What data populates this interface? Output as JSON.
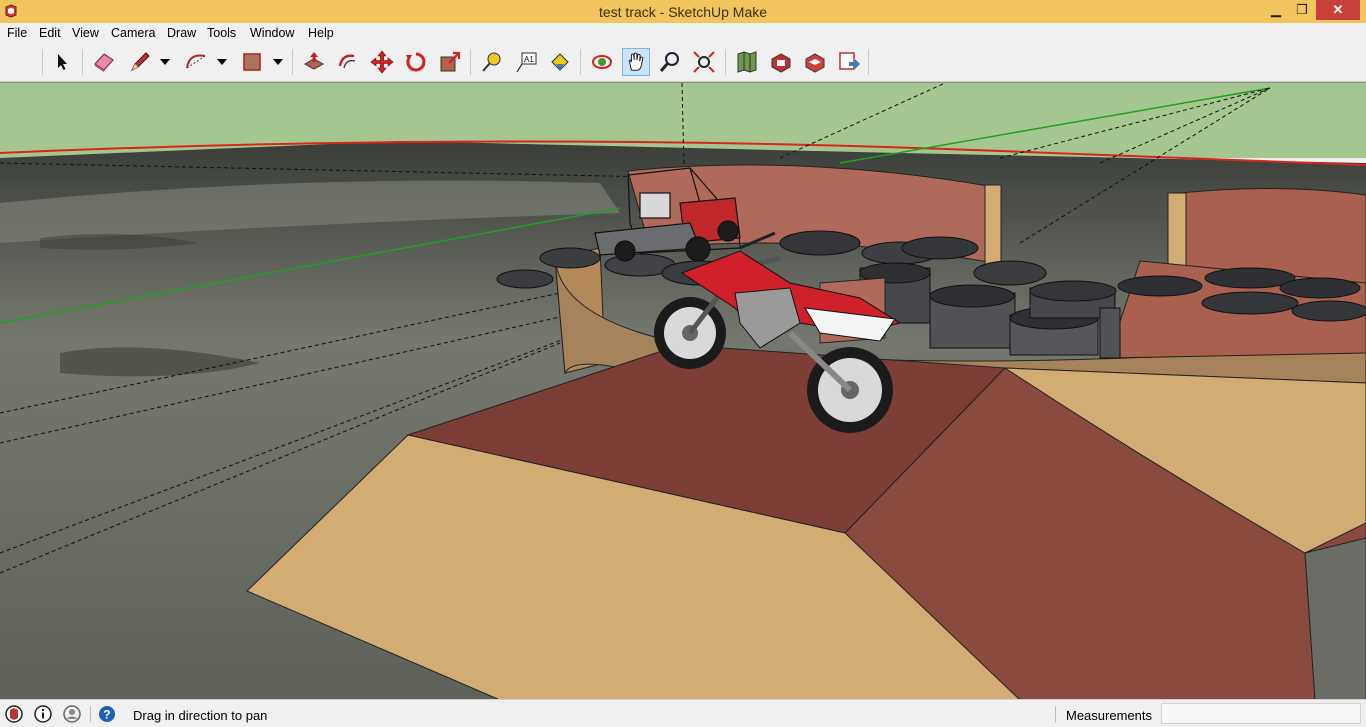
{
  "window": {
    "title": "test track - SketchUp Make",
    "minimize": "▁",
    "restore": "❐",
    "close": "✕"
  },
  "menu": {
    "file": "File",
    "edit": "Edit",
    "view": "View",
    "camera": "Camera",
    "draw": "Draw",
    "tools": "Tools",
    "window": "Window",
    "help": "Help"
  },
  "toolbar": {
    "tools": [
      {
        "icon": "select-arrow-icon"
      },
      {
        "icon": "eraser-icon"
      },
      {
        "icon": "pencil-icon"
      },
      {
        "icon": "arc-icon"
      },
      {
        "icon": "rectangle-icon"
      },
      {
        "icon": "push-pull-icon"
      },
      {
        "icon": "offset-icon"
      },
      {
        "icon": "move-icon"
      },
      {
        "icon": "rotate-icon"
      },
      {
        "icon": "scale-icon"
      },
      {
        "icon": "tape-measure-icon"
      },
      {
        "icon": "text-icon"
      },
      {
        "icon": "paint-bucket-icon"
      },
      {
        "icon": "orbit-icon"
      },
      {
        "icon": "pan-hand-icon",
        "active": true
      },
      {
        "icon": "zoom-icon"
      },
      {
        "icon": "zoom-extents-icon"
      },
      {
        "icon": "geo-location-icon"
      },
      {
        "icon": "3d-warehouse-icon"
      },
      {
        "icon": "extension-warehouse-icon"
      },
      {
        "icon": "send-to-layout-icon"
      }
    ],
    "text_tool_label": "A1"
  },
  "status": {
    "hint": "Drag in direction to pan",
    "measurements_label": "Measurements",
    "measurements_value": ""
  },
  "colors": {
    "titlebar": "#f1c45c",
    "sky": "#a6c690",
    "sand": "#d2ac72",
    "dirt_red": "#8a4a40",
    "bike_red": "#d0202a"
  }
}
